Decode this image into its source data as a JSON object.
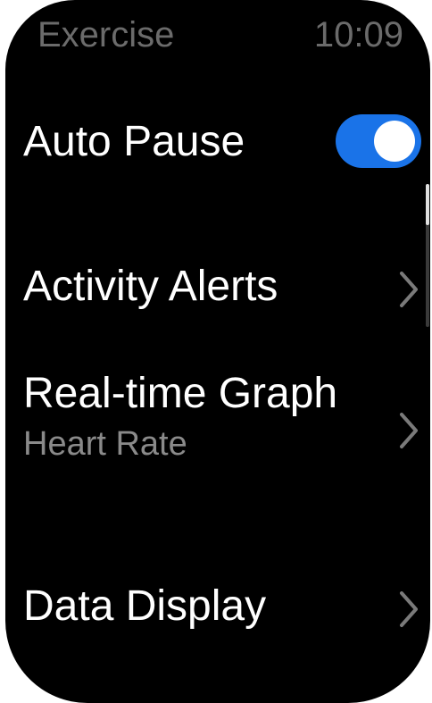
{
  "status_bar": {
    "title": "Exercise",
    "time": "10:09"
  },
  "settings": {
    "auto_pause": {
      "label": "Auto Pause",
      "enabled": true
    },
    "activity_alerts": {
      "label": "Activity Alerts"
    },
    "realtime_graph": {
      "label": "Real-time Graph",
      "value": "Heart Rate"
    },
    "data_display": {
      "label": "Data Display"
    }
  },
  "colors": {
    "background": "#000000",
    "toggle_on": "#1a73e8",
    "primary_text": "#ffffff",
    "secondary_text": "#8a8a8a",
    "status_text": "#6b6b6b"
  },
  "icons": [
    "chevron-right-icon"
  ]
}
